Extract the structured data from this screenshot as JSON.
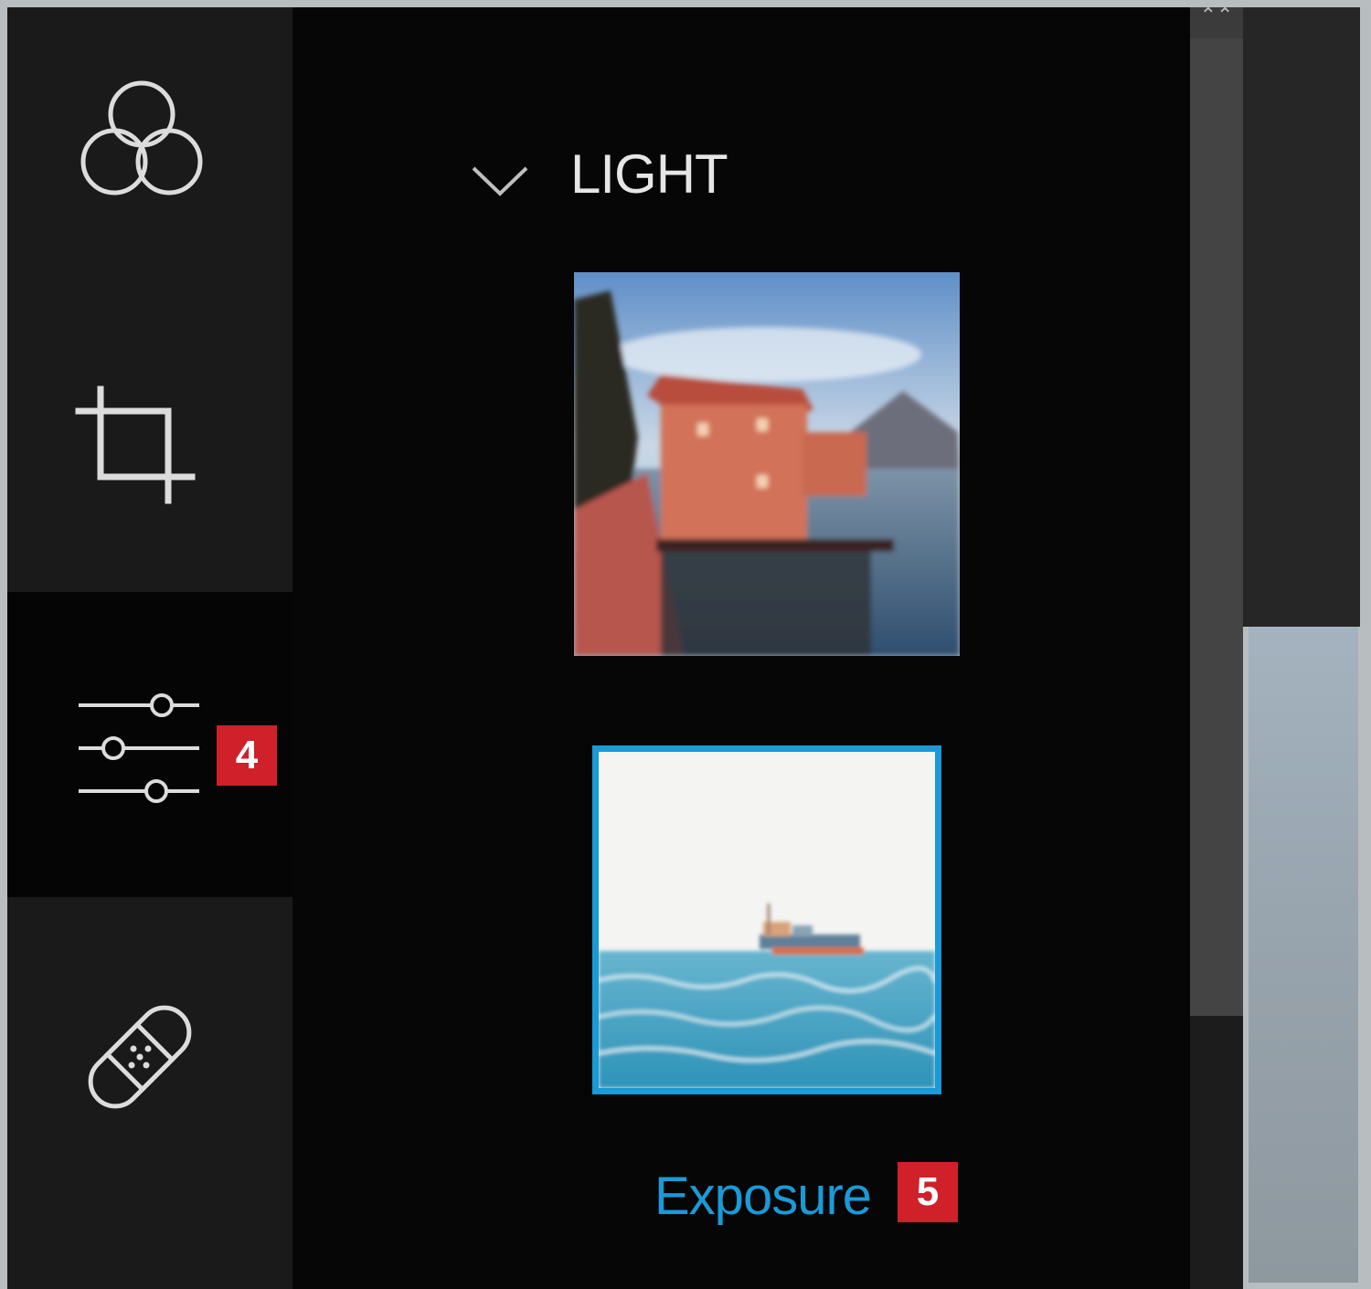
{
  "rail": {
    "items": [
      {
        "name": "looks",
        "icon": "color-circles-icon",
        "active": false
      },
      {
        "name": "crop",
        "icon": "crop-icon",
        "active": false
      },
      {
        "name": "adjust",
        "icon": "sliders-icon",
        "active": true,
        "badge": "4"
      },
      {
        "name": "heal",
        "icon": "bandage-icon",
        "active": false
      }
    ]
  },
  "panel": {
    "section_title": "LIGHT",
    "section_icon": "chevron-down-icon",
    "presets": [
      {
        "name": "boathouse-thumbnail",
        "selected": false
      },
      {
        "name": "sea-boat-thumbnail",
        "selected": true,
        "label": "Exposure",
        "badge": "5"
      }
    ]
  },
  "colors": {
    "accent": "#1a9ad6",
    "badge": "#d0202a",
    "rail_bg": "#1a1a1a",
    "panel_bg": "#060606"
  }
}
